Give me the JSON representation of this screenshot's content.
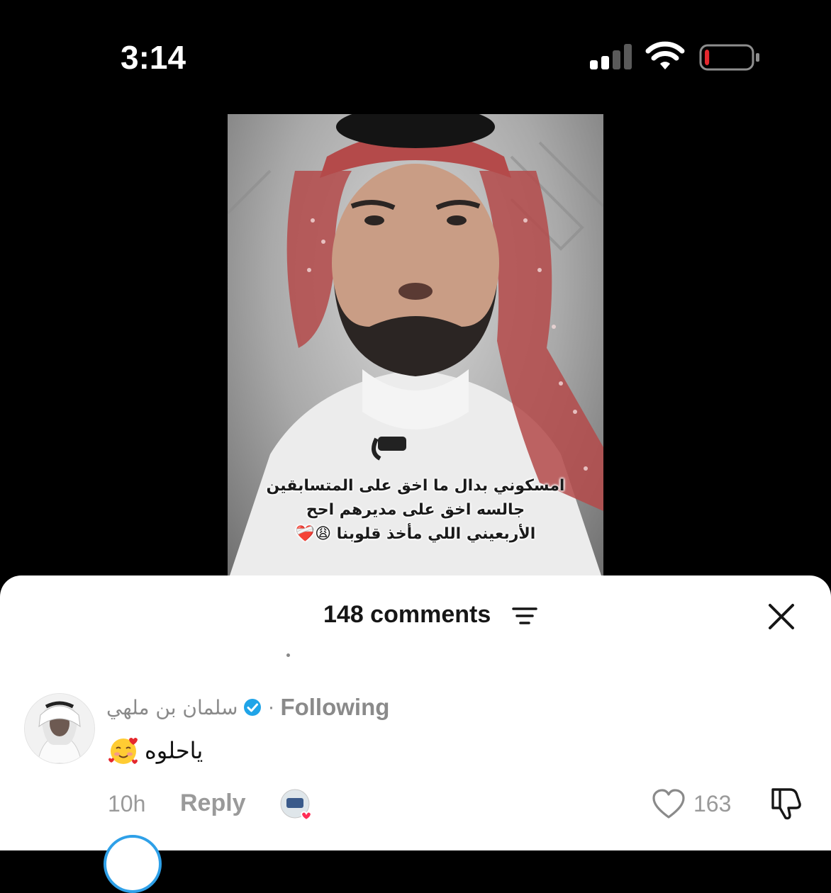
{
  "status_bar": {
    "time": "3:14",
    "signal_icon": "cellular-signal-icon",
    "wifi_icon": "wifi-icon",
    "battery_icon": "battery-low-icon",
    "battery_level": 0.1
  },
  "video": {
    "caption_lines": [
      "امسكوني بدال ما اخق على المتسابقين",
      "جالسه اخق على مديرهم احح",
      "الأربعيني اللي مأخذ قلوبنا 😩❤️‍🩹"
    ]
  },
  "comments_sheet": {
    "count_label": "148 comments",
    "filter_icon": "sort-filter-icon",
    "close_icon": "close-icon",
    "comment": {
      "username": "سلمان بن ملهي",
      "verified_icon": "verified-badge-icon",
      "following_label": "Following",
      "separator": "·",
      "text": "ياحلوه",
      "emoji_icon": "smiling-face-with-hearts-icon",
      "time": "10h",
      "reply_label": "Reply",
      "creator_liked_icon": "creator-liked-heart-icon",
      "like_icon": "heart-outline-icon",
      "like_count": "163",
      "dislike_icon": "thumbs-down-icon"
    }
  },
  "colors": {
    "background_top": "#000000",
    "sheet_background": "#ffffff",
    "muted_text": "#8a8a8a",
    "verified_blue": "#20a4e8",
    "battery_red": "#e5282e"
  }
}
